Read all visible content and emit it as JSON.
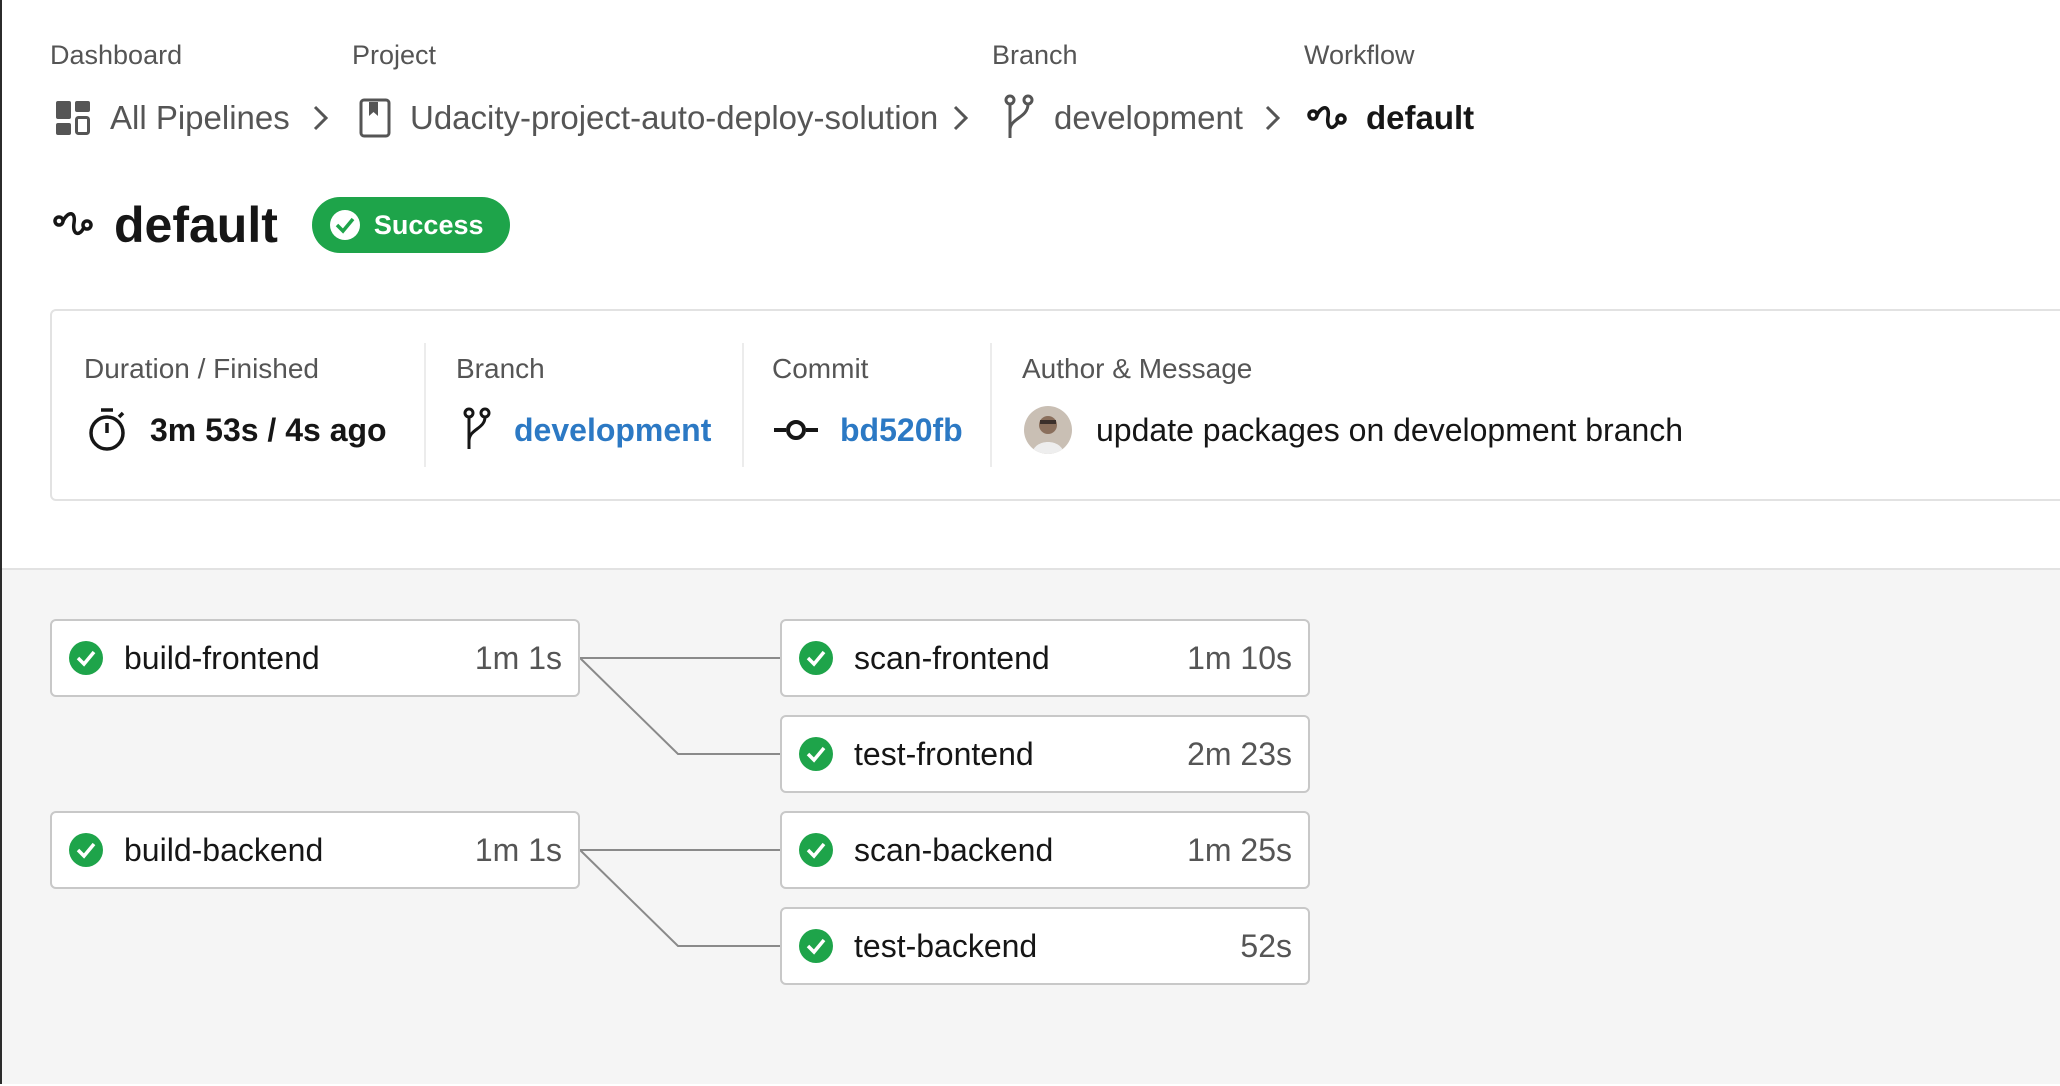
{
  "breadcrumb": {
    "dashboard": {
      "label": "Dashboard",
      "value": "All Pipelines"
    },
    "project": {
      "label": "Project",
      "value": "Udacity-project-auto-deploy-solution"
    },
    "branch": {
      "label": "Branch",
      "value": "development"
    },
    "workflow": {
      "label": "Workflow",
      "value": "default"
    }
  },
  "header": {
    "title": "default",
    "status": "Success"
  },
  "summary": {
    "duration": {
      "label": "Duration / Finished",
      "value": "3m 53s / 4s ago"
    },
    "branch": {
      "label": "Branch",
      "value": "development"
    },
    "commit": {
      "label": "Commit",
      "value": "bd520fb"
    },
    "author": {
      "label": "Author & Message",
      "message": "update packages on development branch"
    }
  },
  "jobs": [
    {
      "name": "build-frontend",
      "duration": "1m 1s",
      "status": "success"
    },
    {
      "name": "scan-frontend",
      "duration": "1m 10s",
      "status": "success"
    },
    {
      "name": "test-frontend",
      "duration": "2m 23s",
      "status": "success"
    },
    {
      "name": "build-backend",
      "duration": "1m 1s",
      "status": "success"
    },
    {
      "name": "scan-backend",
      "duration": "1m 25s",
      "status": "success"
    },
    {
      "name": "test-backend",
      "duration": "52s",
      "status": "success"
    }
  ],
  "colors": {
    "success": "#1ea44a",
    "link": "#2c79c4",
    "text": "#161616",
    "muted": "#555555",
    "canvas": "#f5f5f5"
  },
  "icons": {
    "dashboard": "dashboard-icon",
    "project": "bookmark-icon",
    "branch": "git-branch-icon",
    "workflow": "workflow-icon",
    "duration": "stopwatch-icon",
    "commit": "git-commit-icon",
    "job_status": "check-circle-icon"
  }
}
